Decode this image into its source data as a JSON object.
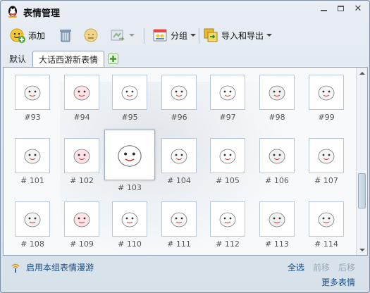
{
  "window": {
    "title": "表情管理"
  },
  "toolbar": {
    "add_label": "添加",
    "group_label": "分组",
    "import_export_label": "导入和导出"
  },
  "tabs": [
    {
      "label": "默认"
    },
    {
      "label": "大话西游新表情"
    }
  ],
  "emoticons": [
    {
      "label": "#93",
      "icon": "ghost-with-red-fists"
    },
    {
      "label": "#94",
      "icon": "ghost-with-envelope"
    },
    {
      "label": "#95",
      "icon": "long-face-ghost"
    },
    {
      "label": "#96",
      "icon": "smiling-ghost"
    },
    {
      "label": "#97",
      "icon": "heart-eyes-ghost"
    },
    {
      "label": "#98",
      "icon": "penguin-group"
    },
    {
      "label": "#99",
      "icon": "sleepy-ghost"
    },
    {
      "label": "# 101",
      "icon": "strong-character-ghost"
    },
    {
      "label": "# 102",
      "icon": "pig-with-bottle"
    },
    {
      "label": "# 103",
      "icon": "ghost-with-rose"
    },
    {
      "label": "# 104",
      "icon": "ghost-with-sign"
    },
    {
      "label": "# 105",
      "icon": "pink-bear"
    },
    {
      "label": "# 106",
      "icon": "ghost-with-mic"
    },
    {
      "label": "# 107",
      "icon": "ghost-with-smoke"
    },
    {
      "label": "# 108",
      "icon": "pig-face"
    },
    {
      "label": "# 109",
      "icon": "egg-ghost"
    },
    {
      "label": "# 110",
      "icon": "group-under-umbrella"
    },
    {
      "label": "# 111",
      "icon": "fading-smoke"
    },
    {
      "label": "# 112",
      "icon": "crying-pig"
    },
    {
      "label": "# 113",
      "icon": "black-hair-ghost"
    },
    {
      "label": "# 114",
      "icon": "blonde-child"
    }
  ],
  "footer": {
    "roam_label": "启用本组表情漫游",
    "select_all": "全选",
    "move_prev": "前移",
    "move_next": "后移",
    "more_emoticons": "更多表情"
  }
}
